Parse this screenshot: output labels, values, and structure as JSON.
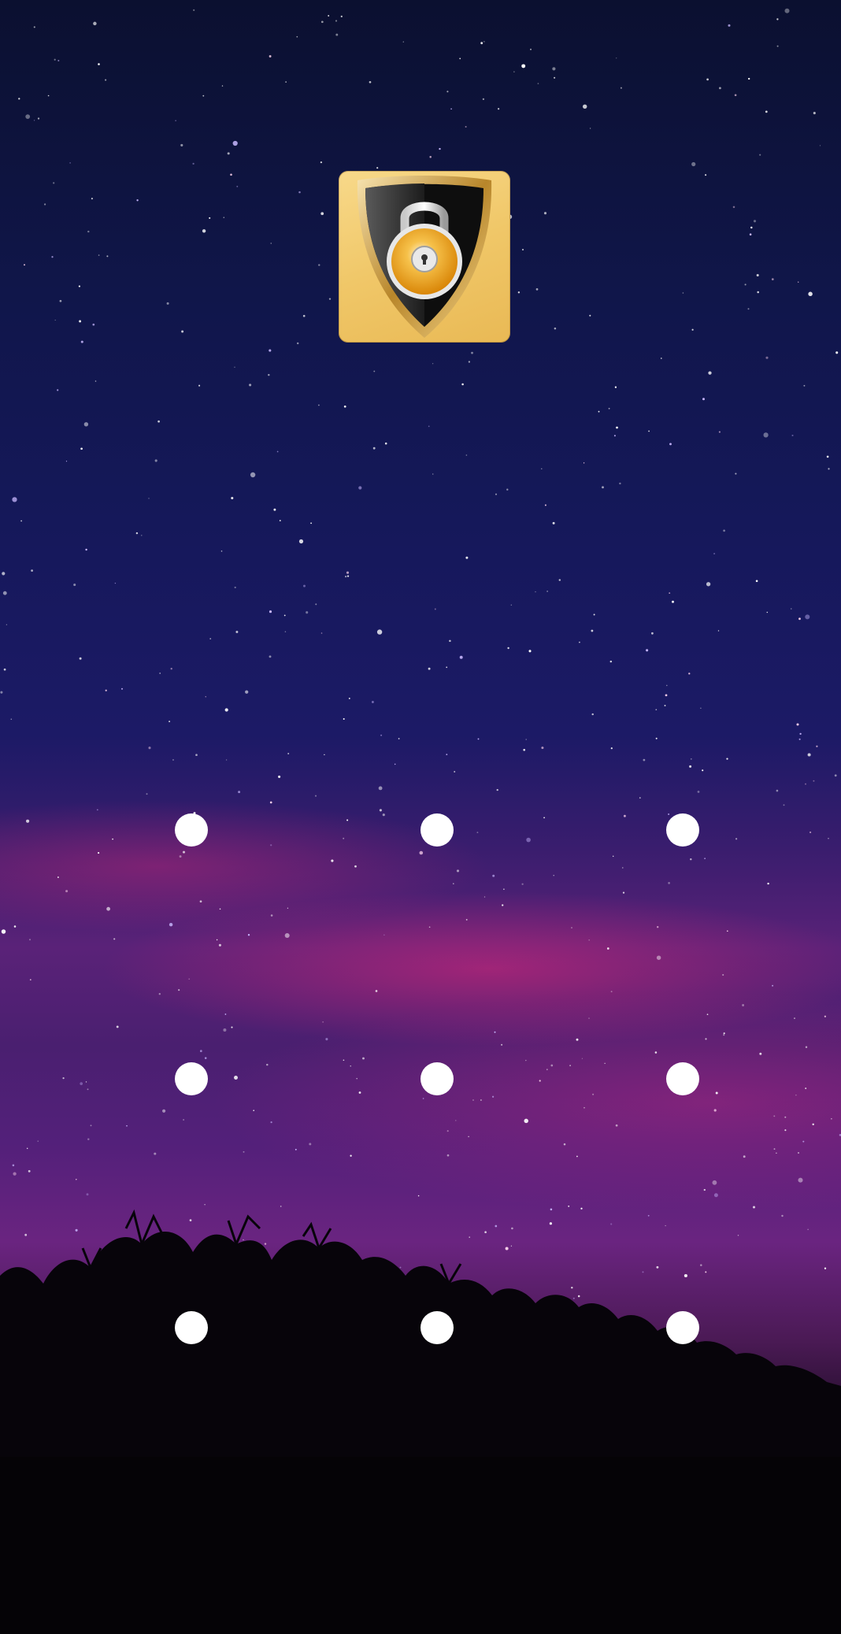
{
  "screen": {
    "background": "night-sky-wallpaper"
  },
  "app_logo": {
    "icon": "shield-padlock-icon",
    "colors": {
      "tile": "#f0c768",
      "shield": "#1a1a1a",
      "shield_rim": "#c9962f",
      "lock_body": "#f2a21b"
    }
  },
  "pattern_lock": {
    "rows": 3,
    "columns": 3,
    "dot_color": "#ffffff",
    "dots": [
      {
        "id": 1
      },
      {
        "id": 2
      },
      {
        "id": 3
      },
      {
        "id": 4
      },
      {
        "id": 5
      },
      {
        "id": 6
      },
      {
        "id": 7
      },
      {
        "id": 8
      },
      {
        "id": 9
      }
    ]
  }
}
